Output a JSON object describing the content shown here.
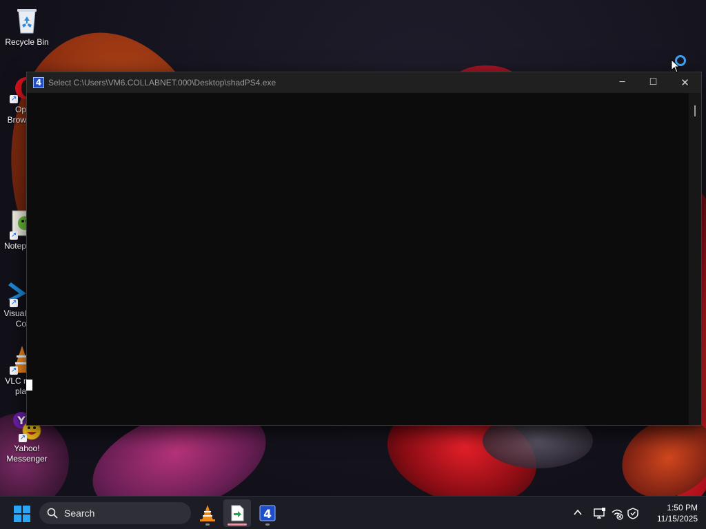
{
  "desktop": {
    "icons": [
      {
        "label": "Recycle Bin",
        "icon": "recycle-bin-icon"
      },
      {
        "label": "Op\nBrow",
        "icon": "opera-browser-icon"
      },
      {
        "label": "Notep",
        "icon": "notepad-plus-plus-icon"
      },
      {
        "label": "Visual\nCo",
        "icon": "visual-studio-code-icon"
      },
      {
        "label": "VLC r\npla",
        "icon": "vlc-player-icon"
      },
      {
        "label": "Yahoo!\nMessenger",
        "icon": "yahoo-messenger-icon"
      }
    ]
  },
  "window": {
    "title": "Select C:\\Users\\VM6.COLLABNET.000\\Desktop\\shadPS4.exe",
    "icon": "shadps4-app-icon",
    "icon_glyph": "4",
    "minimize_glyph": "─",
    "maximize_glyph": "☐",
    "close_glyph": "✕",
    "console_text": ""
  },
  "taskbar": {
    "search_label": "Search",
    "apps": [
      {
        "name": "vlc-player",
        "icon": "vlc-cone-icon",
        "active": false
      },
      {
        "name": "file-manager",
        "icon": "green-arrow-file-icon",
        "active": true
      },
      {
        "name": "shadps4",
        "icon": "shadps4-app-icon",
        "active": false
      }
    ],
    "tray": {
      "chevron_icon": "chevron-up-icon",
      "icons": [
        "display-icon",
        "network-disconnected-icon",
        "shield-icon"
      ]
    },
    "clock": {
      "time": "1:50 PM",
      "date": "11/15/2025"
    }
  },
  "colors": {
    "accent": "#2aa6f5",
    "console_background": "#0c0c0c",
    "titlebar_background": "#202020",
    "taskbar_background": "#1c1c24"
  }
}
